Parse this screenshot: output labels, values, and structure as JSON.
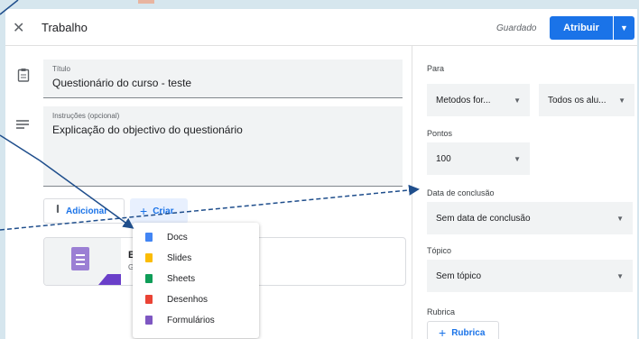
{
  "header": {
    "title": "Trabalho",
    "saved": "Guardado",
    "assign_label": "Atribuir"
  },
  "form": {
    "title_label": "Título",
    "title_value": "Questionário do curso - teste",
    "instructions_label": "Instruções (opcional)",
    "instructions_value": "Explicação do objectivo do questionário",
    "add_label": "Adicionar",
    "create_label": "Criar"
  },
  "attachment": {
    "title_partial": "Bl",
    "subtitle_partial": "Gc"
  },
  "create_menu": {
    "items": [
      {
        "label": "Docs",
        "color": "#4285f4"
      },
      {
        "label": "Slides",
        "color": "#fbbc04"
      },
      {
        "label": "Sheets",
        "color": "#0f9d58"
      },
      {
        "label": "Desenhos",
        "color": "#ea4335"
      },
      {
        "label": "Formulários",
        "color": "#7e57c2"
      }
    ]
  },
  "sidebar": {
    "for_label": "Para",
    "class_value": "Metodos for...",
    "students_value": "Todos os alu...",
    "points_label": "Pontos",
    "points_value": "100",
    "due_label": "Data de conclusão",
    "due_value": "Sem data de conclusão",
    "topic_label": "Tópico",
    "topic_value": "Sem tópico",
    "rubric_label": "Rubrica",
    "rubric_button": "Rubrica"
  },
  "colors": {
    "accent": "#1a73e8",
    "arrow": "#1f4e8c",
    "background": "#d6e6ee"
  }
}
